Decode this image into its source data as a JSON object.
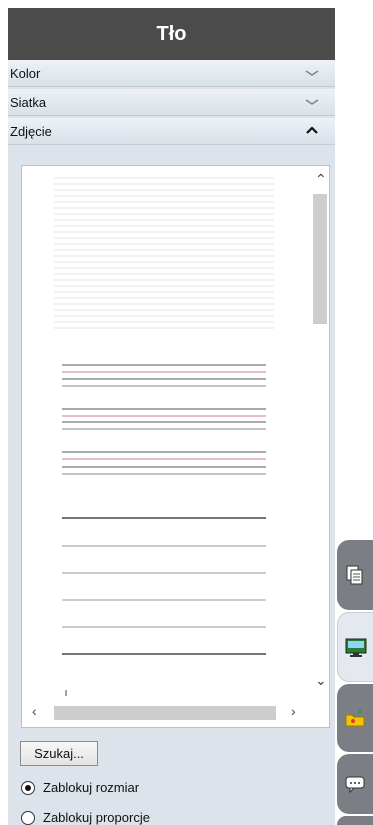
{
  "panel": {
    "title": "Tło",
    "sections": [
      {
        "label": "Kolor",
        "expanded": false
      },
      {
        "label": "Siatka",
        "expanded": false
      },
      {
        "label": "Zdjęcie",
        "expanded": true
      }
    ]
  },
  "image_section": {
    "search_button": "Szukaj...",
    "options": [
      {
        "label": "Zablokuj rozmiar",
        "selected": true
      },
      {
        "label": "Zablokuj proporcje",
        "selected": false
      }
    ]
  },
  "side_tabs": [
    {
      "icon": "pages-icon"
    },
    {
      "icon": "background-icon"
    },
    {
      "icon": "gallery-icon"
    },
    {
      "icon": "comment-icon"
    }
  ],
  "colors": {
    "title_bar": "#4b4b4b",
    "panel_bg": "#dde3ea",
    "ruled_red": "#c9828a"
  }
}
